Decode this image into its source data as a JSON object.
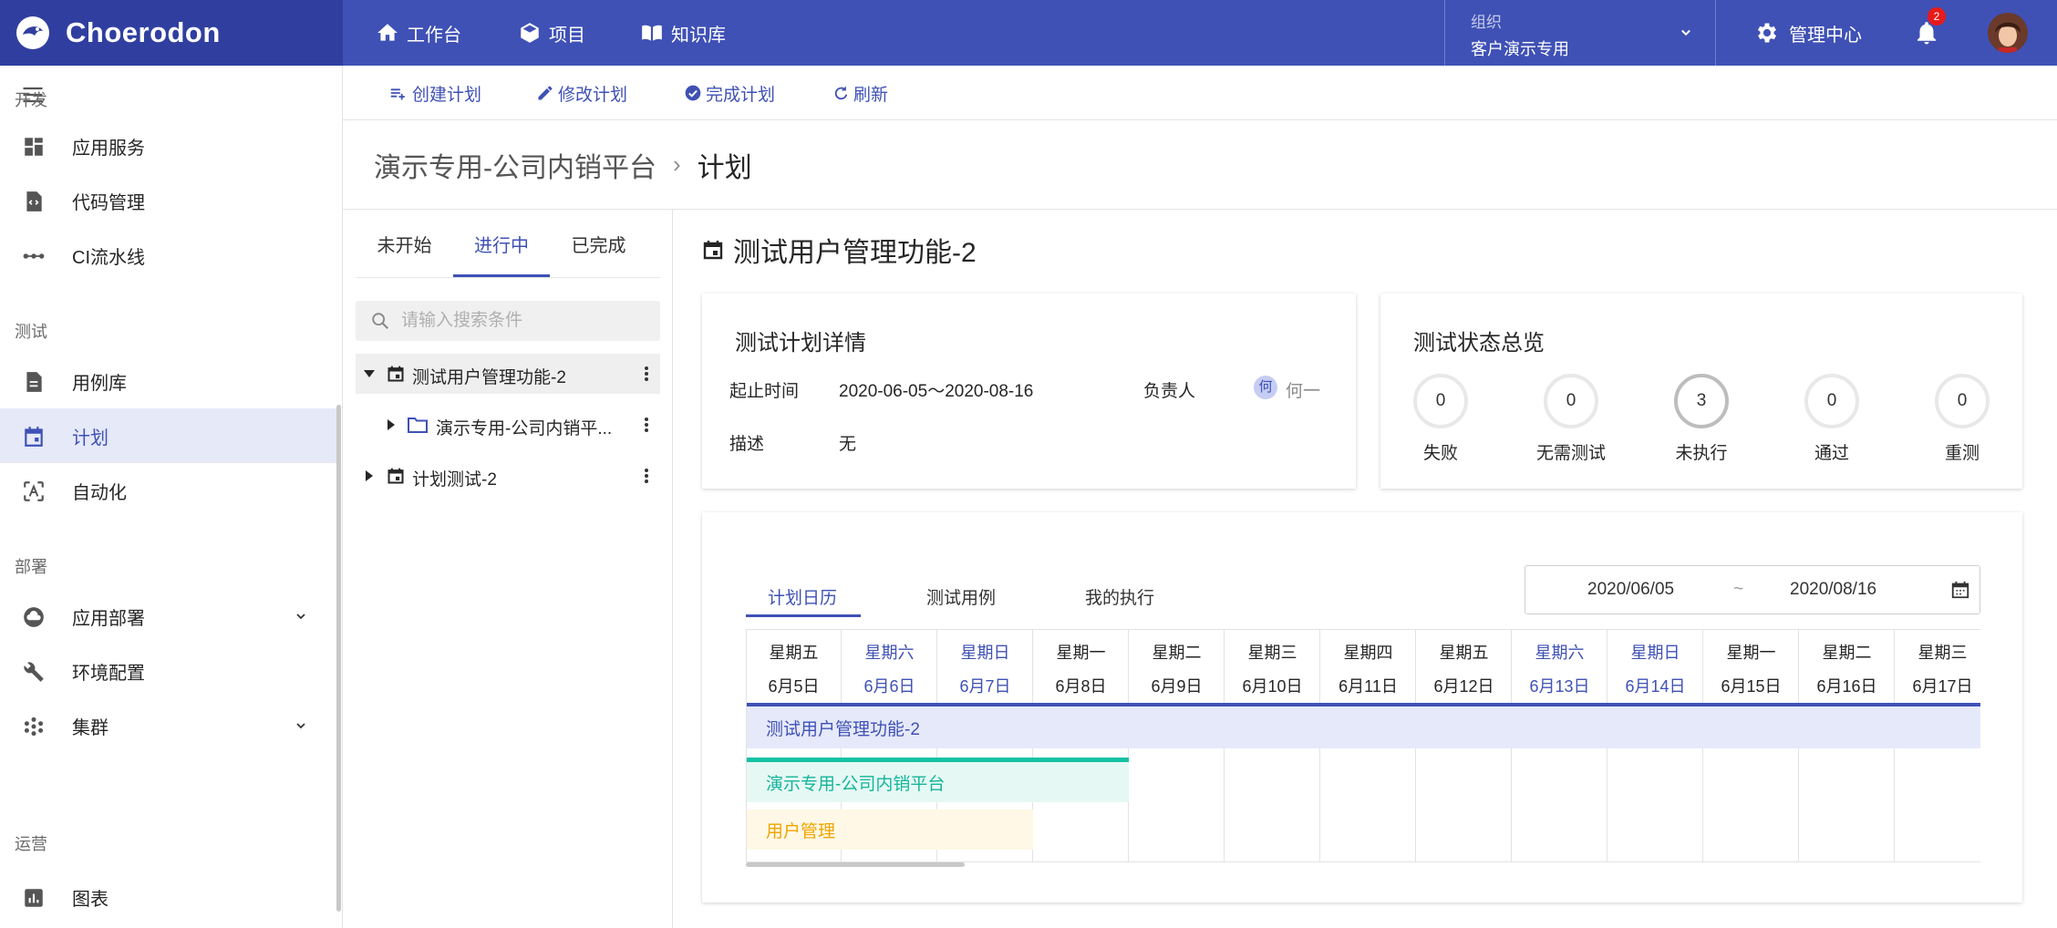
{
  "topbar": {
    "brand": "Choerodon",
    "nav": [
      {
        "label": "工作台",
        "icon": "home-icon"
      },
      {
        "label": "项目",
        "icon": "cube-icon"
      },
      {
        "label": "知识库",
        "icon": "book-icon"
      }
    ],
    "org_label": "组织",
    "org_value": "客户演示专用",
    "admin_label": "管理中心",
    "notification_count": "2",
    "colors": {
      "topbar": "#3f51b5",
      "brand_bg": "#303f9f"
    }
  },
  "sidebar": {
    "groups": [
      {
        "label": "开发",
        "items": [
          {
            "label": "应用服务",
            "icon": "dashboard-icon"
          },
          {
            "label": "代码管理",
            "icon": "code-file-icon"
          },
          {
            "label": "CI流水线",
            "icon": "pipeline-icon"
          }
        ]
      },
      {
        "label": "测试",
        "items": [
          {
            "label": "用例库",
            "icon": "document-icon"
          },
          {
            "label": "计划",
            "icon": "calendar-icon",
            "active": true
          },
          {
            "label": "自动化",
            "icon": "automation-icon"
          }
        ]
      },
      {
        "label": "部署",
        "items": [
          {
            "label": "应用部署",
            "icon": "cloud-icon",
            "expandable": true
          },
          {
            "label": "环境配置",
            "icon": "wrench-icon"
          },
          {
            "label": "集群",
            "icon": "cluster-icon",
            "expandable": true
          }
        ]
      },
      {
        "label": "运营",
        "items": [
          {
            "label": "图表",
            "icon": "chart-icon"
          }
        ]
      }
    ]
  },
  "actions": [
    {
      "label": "创建计划",
      "icon": "playlist-add-icon"
    },
    {
      "label": "修改计划",
      "icon": "edit-icon"
    },
    {
      "label": "完成计划",
      "icon": "check-circle-icon"
    },
    {
      "label": "刷新",
      "icon": "refresh-icon"
    }
  ],
  "breadcrumb": {
    "project": "演示专用-公司内销平台",
    "separator": "›",
    "current": "计划"
  },
  "tree": {
    "tabs": [
      "未开始",
      "进行中",
      "已完成"
    ],
    "active_tab": "进行中",
    "search_placeholder": "请输入搜索条件",
    "nodes": [
      {
        "label": "测试用户管理功能-2",
        "expanded": true,
        "selected": true
      },
      {
        "label": "演示专用-公司内销平...",
        "type": "folder"
      },
      {
        "label": "计划测试-2",
        "expanded": false
      }
    ]
  },
  "detail": {
    "title": "测试用户管理功能-2",
    "info_card": {
      "title": "测试计划详情",
      "period_label": "起止时间",
      "period_value": "2020-06-05～2020-08-16",
      "owner_label": "负责人",
      "owner_initial": "何",
      "owner_name": "何一",
      "desc_label": "描述",
      "desc_value": "无"
    },
    "status_card": {
      "title": "测试状态总览",
      "stats": [
        {
          "label": "失败",
          "value": "0"
        },
        {
          "label": "无需测试",
          "value": "0"
        },
        {
          "label": "未执行",
          "value": "3"
        },
        {
          "label": "通过",
          "value": "0"
        },
        {
          "label": "重测",
          "value": "0"
        }
      ]
    },
    "calendar_card": {
      "tabs": [
        "计划日历",
        "测试用例",
        "我的执行"
      ],
      "active_tab": "计划日历",
      "date_from": "2020/06/05",
      "date_sep": "~",
      "date_to": "2020/08/16",
      "days": [
        {
          "weekday": "星期五",
          "date": "6月5日",
          "weekend": false
        },
        {
          "weekday": "星期六",
          "date": "6月6日",
          "weekend": true
        },
        {
          "weekday": "星期日",
          "date": "6月7日",
          "weekend": true
        },
        {
          "weekday": "星期一",
          "date": "6月8日",
          "weekend": false
        },
        {
          "weekday": "星期二",
          "date": "6月9日",
          "weekend": false
        },
        {
          "weekday": "星期三",
          "date": "6月10日",
          "weekend": false
        },
        {
          "weekday": "星期四",
          "date": "6月11日",
          "weekend": false
        },
        {
          "weekday": "星期五",
          "date": "6月12日",
          "weekend": false
        },
        {
          "weekday": "星期六",
          "date": "6月13日",
          "weekend": true
        },
        {
          "weekday": "星期日",
          "date": "6月14日",
          "weekend": true
        },
        {
          "weekday": "星期一",
          "date": "6月15日",
          "weekend": false
        },
        {
          "weekday": "星期二",
          "date": "6月16日",
          "weekend": false
        },
        {
          "weekday": "星期三",
          "date": "6月17日",
          "weekend": false
        }
      ],
      "bars": {
        "plan": "测试用户管理功能-2",
        "project": "演示专用-公司内销平台",
        "folder": "用户管理"
      },
      "colors": {
        "plan": "#3f51b5",
        "project": "#13c2a3",
        "folder": "#f0a500"
      }
    }
  }
}
